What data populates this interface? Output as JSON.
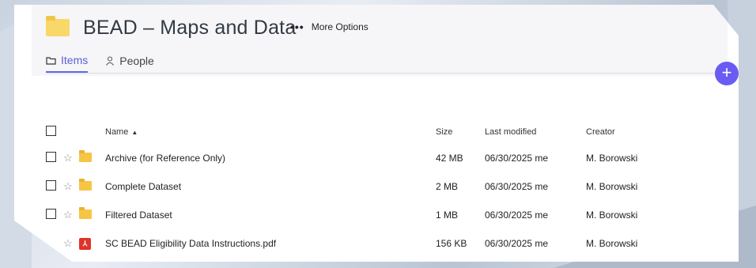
{
  "header": {
    "title": "BEAD – Maps and Data",
    "more_label": "More Options"
  },
  "tabs": [
    {
      "label": "Items",
      "icon": "folder-outline-icon",
      "active": true
    },
    {
      "label": "People",
      "icon": "person-icon",
      "active": false
    }
  ],
  "fab": {
    "icon": "plus-icon"
  },
  "table": {
    "headers": {
      "name": "Name",
      "sort_indicator": "▲",
      "size": "Size",
      "modified": "Last modified",
      "creator": "Creator"
    },
    "rows": [
      {
        "name": "Archive (for Reference Only)",
        "size": "42 MB",
        "modified": "06/30/2025 me",
        "creator": "M. Borowski",
        "type": "folder"
      },
      {
        "name": "Complete Dataset",
        "size": "2 MB",
        "modified": "06/30/2025 me",
        "creator": "M. Borowski",
        "type": "folder"
      },
      {
        "name": "Filtered Dataset",
        "size": "1 MB",
        "modified": "06/30/2025 me",
        "creator": "M. Borowski",
        "type": "folder"
      },
      {
        "name": "SC BEAD Eligibility Data Instructions.pdf",
        "size": "156 KB",
        "modified": "06/30/2025 me",
        "creator": "M. Borowski",
        "type": "pdf"
      }
    ]
  },
  "colors": {
    "accent": "#6468e8",
    "fab": "#6a5cf2",
    "folder": "#f6c544",
    "pdf": "#e0332b"
  }
}
